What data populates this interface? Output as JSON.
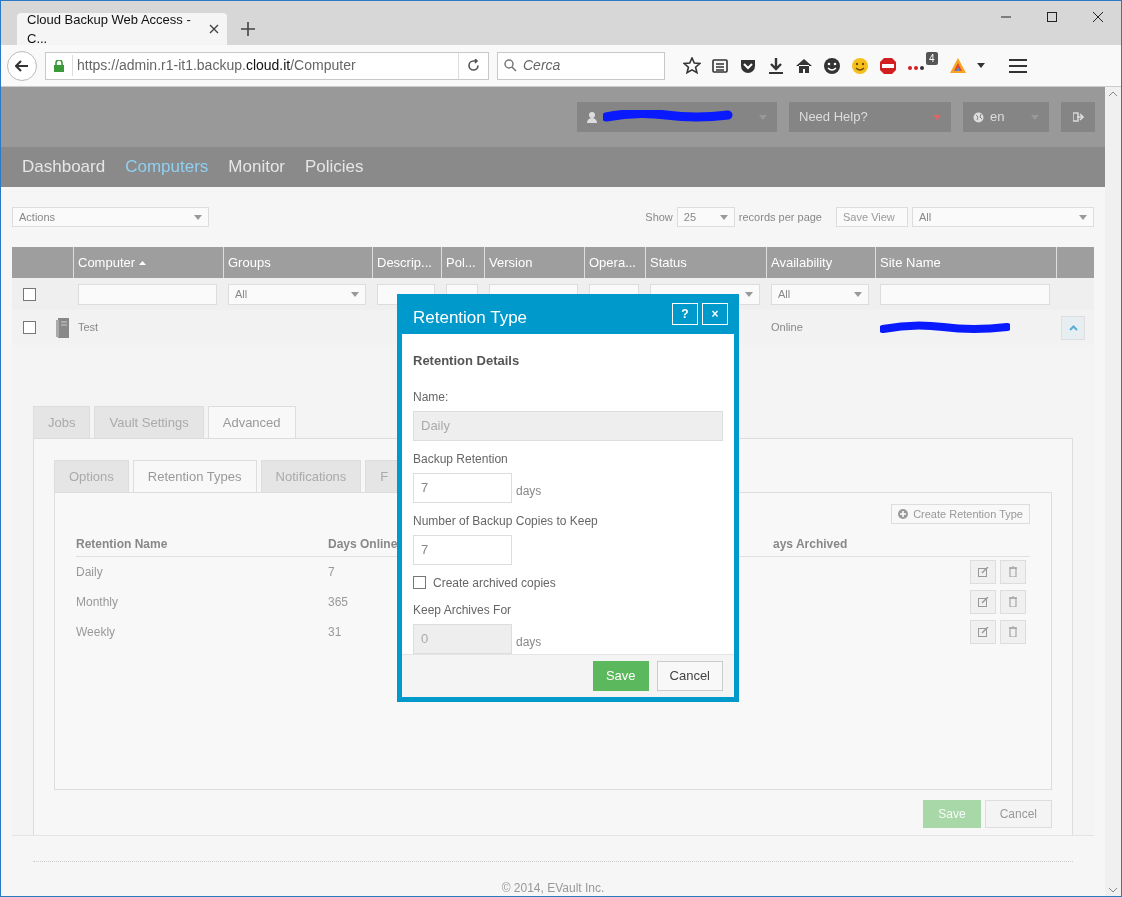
{
  "browser": {
    "tab_title": "Cloud Backup Web Access - C...",
    "url_scheme": "https://admin.r1-it1.backup.",
    "url_domain": "cloud.it",
    "url_path": "/Computer",
    "search_placeholder": "Cerca",
    "extension_badge": "4"
  },
  "header": {
    "help": "Need Help?",
    "language": "en"
  },
  "nav": [
    {
      "label": "Dashboard",
      "selected": false
    },
    {
      "label": "Computers",
      "selected": true
    },
    {
      "label": "Monitor",
      "selected": false
    },
    {
      "label": "Policies",
      "selected": false
    }
  ],
  "toolbar": {
    "actions": "Actions",
    "show": "Show",
    "per_page": "25",
    "records": "records per page",
    "save_view": {
      "label": "Save View",
      "disabled": true
    },
    "view": "All"
  },
  "table": {
    "columns": [
      {
        "label": "Computer",
        "sorted": true
      },
      {
        "label": "Groups",
        "sorted": false
      },
      {
        "label": "Descrip...",
        "sorted": false
      },
      {
        "label": "Pol...",
        "sorted": false
      },
      {
        "label": "Version",
        "sorted": false
      },
      {
        "label": "Opera...",
        "sorted": false
      },
      {
        "label": "Status",
        "sorted": false
      },
      {
        "label": "Availability",
        "sorted": false
      },
      {
        "label": "Site Name",
        "sorted": false
      }
    ],
    "filters": [
      {
        "kind": "checkbox",
        "checked": false
      },
      {
        "kind": "input"
      },
      {
        "kind": "select",
        "value": "All"
      },
      {
        "kind": "input"
      },
      {
        "kind": "input"
      },
      {
        "kind": "input"
      },
      {
        "kind": "input"
      },
      {
        "kind": "select"
      },
      {
        "kind": "select",
        "value": "All"
      },
      {
        "kind": "input"
      },
      {
        "kind": "none"
      }
    ],
    "rows": [
      {
        "checked": false,
        "name": "Test",
        "availability": "Online",
        "expanded": true
      }
    ]
  },
  "outer_tabs": [
    {
      "label": "Jobs",
      "selected": false
    },
    {
      "label": "Vault Settings",
      "selected": false
    },
    {
      "label": "Advanced",
      "selected": true
    }
  ],
  "inner_tabs": [
    {
      "label": "Options",
      "selected": false
    },
    {
      "label": "Retention Types",
      "selected": true
    },
    {
      "label": "Notifications",
      "selected": false
    },
    {
      "label": "F",
      "selected": false
    }
  ],
  "create_button": "Create Retention Type",
  "retention_table": {
    "columns": [
      "Retention Name",
      "Days Online",
      "ays Archived"
    ],
    "rows": [
      {
        "name": "Daily",
        "days_online": "7"
      },
      {
        "name": "Monthly",
        "days_online": "365"
      },
      {
        "name": "Weekly",
        "days_online": "31"
      }
    ]
  },
  "panel_buttons": [
    {
      "label": "Save",
      "kind": "primary",
      "disabled": true
    },
    {
      "label": "Cancel",
      "kind": "secondary",
      "disabled": false
    }
  ],
  "footer": "© 2014, EVault Inc.",
  "modal": {
    "title": "Retention Type",
    "help": "?",
    "close": "×",
    "section": "Retention Details",
    "name_label": "Name:",
    "name_value": "Daily",
    "name_disabled": true,
    "retention_label": "Backup Retention",
    "retention_value": "7",
    "retention_unit": "days",
    "copies_label": "Number of Backup Copies to Keep",
    "copies_value": "7",
    "archive_label": "Create archived copies",
    "archive_checked": false,
    "keep_label": "Keep Archives For",
    "keep_value": "0",
    "keep_unit": "days",
    "keep_disabled": true,
    "buttons": [
      {
        "label": "Save",
        "kind": "primary"
      },
      {
        "label": "Cancel",
        "kind": "secondary"
      }
    ]
  }
}
